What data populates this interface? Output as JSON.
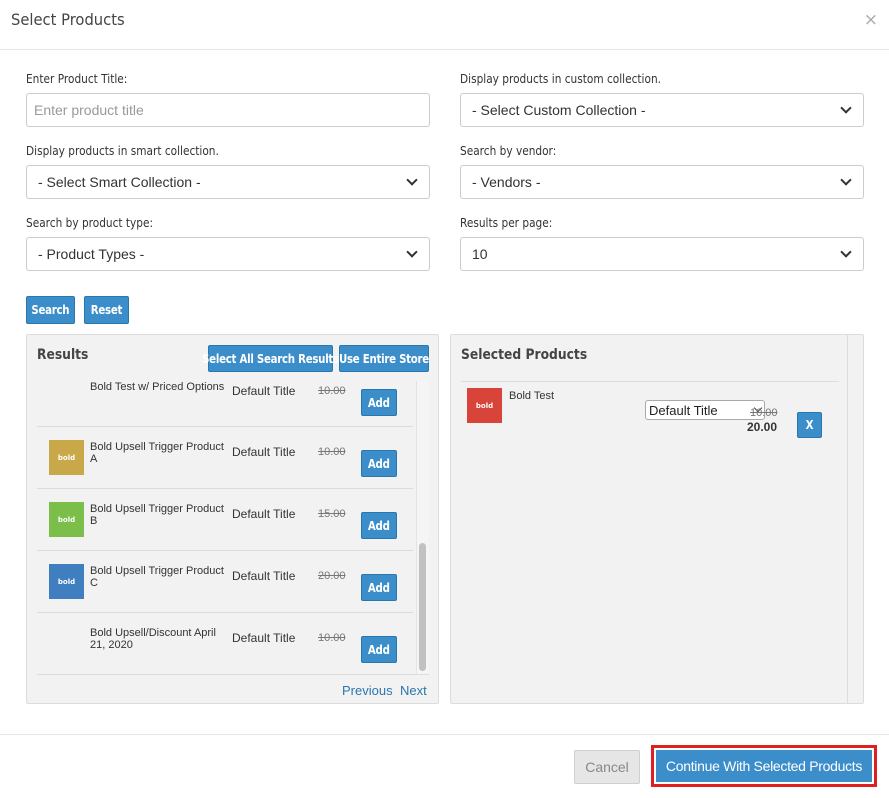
{
  "modal": {
    "title": "Select Products",
    "close_glyph": "×"
  },
  "form": {
    "product_title_label": "Enter Product Title:",
    "product_title_placeholder": "Enter product title",
    "product_title_value": "",
    "custom_collection_label": "Display products in custom collection.",
    "custom_collection_value": "- Select Custom Collection -",
    "smart_collection_label": "Display products in smart collection.",
    "smart_collection_value": "- Select Smart Collection -",
    "vendor_label": "Search by vendor:",
    "vendor_value": "- Vendors -",
    "product_type_label": "Search by product type:",
    "product_type_value": "- Product Types -",
    "per_page_label": "Results per page:",
    "per_page_value": "10",
    "search_button": "Search",
    "reset_button": "Reset"
  },
  "results": {
    "title": "Results",
    "select_all_button": "Select All Search Results",
    "use_store_button": "Use Entire Store",
    "items": [
      {
        "name": "Bold Test w/ Priced Options",
        "variant": "Default Title",
        "price": "10.00",
        "add": "Add",
        "thumb_color": "",
        "thumb_text": ""
      },
      {
        "name": "Bold Upsell Trigger Product A",
        "variant": "Default Title",
        "price": "10.00",
        "add": "Add",
        "thumb_color": "#c9a84a",
        "thumb_text": "bold"
      },
      {
        "name": "Bold Upsell Trigger Product B",
        "variant": "Default Title",
        "price": "15.00",
        "add": "Add",
        "thumb_color": "#7bbf4a",
        "thumb_text": "bold"
      },
      {
        "name": "Bold Upsell Trigger Product C",
        "variant": "Default Title",
        "price": "20.00",
        "add": "Add",
        "thumb_color": "#3f7fc0",
        "thumb_text": "bold"
      },
      {
        "name": "Bold Upsell/Discount April 21, 2020",
        "variant": "Default Title",
        "price": "10.00",
        "add": "Add",
        "thumb_color": "",
        "thumb_text": ""
      }
    ],
    "previous": "Previous",
    "next": "Next"
  },
  "selected": {
    "title": "Selected Products",
    "items": [
      {
        "name": "Bold Test",
        "variant": "Default Title",
        "old_price": "10.00",
        "price": "20.00",
        "remove": "X",
        "thumb_color": "#d9443a",
        "thumb_text": "bold"
      }
    ]
  },
  "footer": {
    "cancel_button": "Cancel",
    "continue_button": "Continue With Selected Products",
    "highlight_color": "#e02020"
  }
}
